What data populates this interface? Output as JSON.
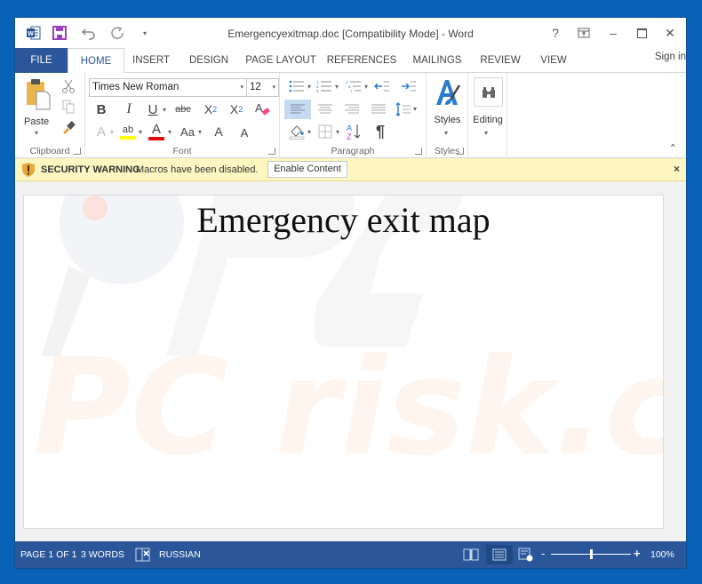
{
  "window": {
    "title": "Emergencyexitmap.doc [Compatibility Mode] - Word",
    "controls": {
      "help": "?",
      "ribbon_options": "ribbon-display-options",
      "minimize": "–",
      "maximize": "☐",
      "close": "✕"
    }
  },
  "qat": [
    {
      "name": "word-logo-icon"
    },
    {
      "name": "save-icon"
    },
    {
      "name": "undo-icon"
    },
    {
      "name": "redo-icon"
    },
    {
      "name": "customize-qat-icon"
    }
  ],
  "tabs": [
    {
      "label": "FILE"
    },
    {
      "label": "HOME",
      "active": true
    },
    {
      "label": "INSERT"
    },
    {
      "label": "DESIGN"
    },
    {
      "label": "PAGE LAYOUT"
    },
    {
      "label": "REFERENCES"
    },
    {
      "label": "MAILINGS"
    },
    {
      "label": "REVIEW"
    },
    {
      "label": "VIEW"
    }
  ],
  "signin": "Sign in",
  "ribbon": {
    "clipboard": {
      "label": "Clipboard",
      "paste": "Paste"
    },
    "font": {
      "label": "Font",
      "font_name": "Times New Roman",
      "font_size": "12",
      "bold": "B",
      "italic": "I",
      "underline": "U",
      "strike": "abc",
      "subscript": "X",
      "sub_mark": "2",
      "superscript": "X",
      "sup_mark": "2",
      "text_effects": "A",
      "highlight": "ab",
      "font_color": "A",
      "change_case": "Aa",
      "grow": "A",
      "shrink": "A"
    },
    "paragraph": {
      "label": "Paragraph",
      "pilcrow": "¶",
      "sort_a": "A",
      "sort_z": "Z"
    },
    "styles": {
      "label": "Styles",
      "button": "Styles"
    },
    "editing": {
      "button": "Editing"
    }
  },
  "security_bar": {
    "title": "SECURITY WARNING",
    "message": "Macros have been disabled.",
    "button": "Enable Content",
    "close": "×"
  },
  "document": {
    "heading": "Emergency exit map",
    "watermark": "PC risk.com"
  },
  "status": {
    "page": "PAGE 1 OF 1",
    "words": "3 WORDS",
    "language": "RUSSIAN",
    "zoom_level": "100%",
    "zoom_fraction": 0.5,
    "zoom_minus": "-",
    "zoom_plus": "+"
  },
  "colors": {
    "desktop": "#0a62b8",
    "accent": "#2b579a",
    "message_bar": "#fcf6c0",
    "highlight_yellow": "#ffff00",
    "font_red": "#e01010"
  }
}
